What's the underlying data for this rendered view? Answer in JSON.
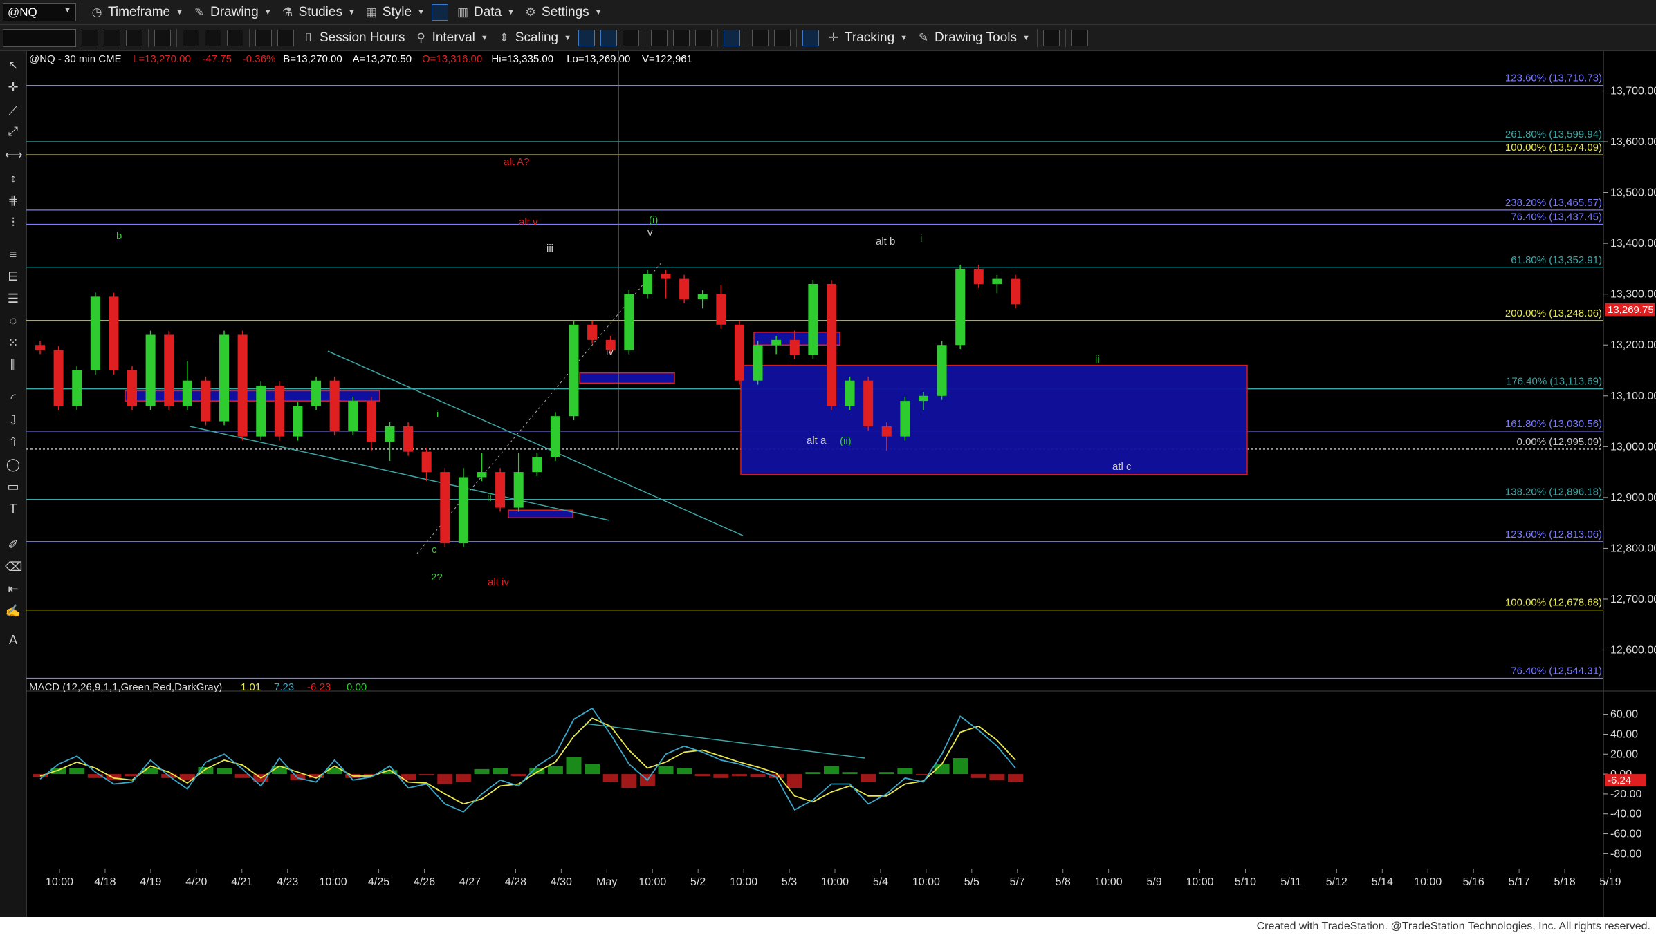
{
  "toolbar_top": {
    "symbol": "@NQ",
    "items": [
      {
        "name": "timeframe-button",
        "label": "Timeframe",
        "icon": "clock-icon"
      },
      {
        "name": "drawing-button",
        "label": "Drawing",
        "icon": "pen-icon"
      },
      {
        "name": "studies-button",
        "label": "Studies",
        "icon": "flask-icon"
      },
      {
        "name": "style-button",
        "label": "Style",
        "icon": "style-icon"
      },
      {
        "name": "data-button",
        "label": "Data",
        "icon": "bar-chart-icon"
      },
      {
        "name": "settings-button",
        "label": "Settings",
        "icon": "gear-icon"
      }
    ]
  },
  "toolbar_second": {
    "session_label": "Session Hours",
    "interval_label": "Interval",
    "scaling_label": "Scaling",
    "tracking_label": "Tracking",
    "drawing_tools_label": "Drawing Tools"
  },
  "chart_header": {
    "symbol_text": "@NQ - 30 min  CME",
    "last": "L=13,270.00",
    "change": "-47.75",
    "pct": "-0.36%",
    "bid": "B=13,270.00",
    "ask": "A=13,270.50",
    "open": "O=13,316.00",
    "high": "Hi=13,335.00",
    "low": "Lo=13,269.00",
    "volume": "V=122,961"
  },
  "macd_header": {
    "title": "MACD (12,26,9,1,1,Green,Red,DarkGray)",
    "v1": "1.01",
    "v2": "7.23",
    "v3": "-6.23",
    "v4": "0.00"
  },
  "footer_text": "Created with TradeStation. @TradeStation Technologies, Inc. All rights reserved.",
  "chart_data": [
    {
      "type": "candlestick",
      "title": "@NQ - 30 min",
      "y_ticks": [
        "13,700.00",
        "13,600.00",
        "13,500.00",
        "13,400.00",
        "13,300.00",
        "13,200.00",
        "13,100.00",
        "13,000.00",
        "12,900.00",
        "12,800.00",
        "12,700.00",
        "12,600.00"
      ],
      "ylim": [
        12530,
        13770
      ],
      "last_price": "13,269.75",
      "x_ticks": [
        "10:00",
        "4/18",
        "4/19",
        "4/20",
        "4/21",
        "4/23",
        "10:00",
        "4/25",
        "4/26",
        "4/27",
        "4/28",
        "4/30",
        "May",
        "10:00",
        "5/2",
        "10:00",
        "5/3",
        "10:00",
        "5/4",
        "10:00",
        "5/5",
        "5/7",
        "5/8",
        "10:00",
        "5/9",
        "10:00",
        "5/10",
        "5/11",
        "5/12",
        "5/14",
        "10:00",
        "5/16",
        "5/17",
        "5/18",
        "5/19"
      ],
      "fib_levels": [
        {
          "label": "123.60% (13,710.73)",
          "value": 13710.73,
          "color": "#7b7bff"
        },
        {
          "label": "261.80% (13,599.94)",
          "value": 13599.94,
          "color": "#3aa6a6"
        },
        {
          "label": "100.00% (13,574.09)",
          "value": 13574.09,
          "color": "#e8e84a"
        },
        {
          "label": "238.20% (13,465.57)",
          "value": 13465.57,
          "color": "#7b7bff"
        },
        {
          "label": "76.40% (13,437.45)",
          "value": 13437.45,
          "color": "#7b7bff"
        },
        {
          "label": "61.80% (13,352.91)",
          "value": 13352.91,
          "color": "#3aa6a6"
        },
        {
          "label": "200.00% (13,248.06)",
          "value": 13248.06,
          "color": "#e8e84a"
        },
        {
          "label": "176.40% (13,113.69)",
          "value": 13113.69,
          "color": "#3aa6a6"
        },
        {
          "label": "161.80% (13,030.56)",
          "value": 13030.56,
          "color": "#7b7bff"
        },
        {
          "label": "0.00% (12,995.09)",
          "value": 12995.09,
          "color": "#cccccc"
        },
        {
          "label": "138.20% (12,896.18)",
          "value": 12896.18,
          "color": "#3aa6a6"
        },
        {
          "label": "123.60% (12,813.06)",
          "value": 12813.06,
          "color": "#7b7bff"
        },
        {
          "label": "100.00% (12,678.68)",
          "value": 12678.68,
          "color": "#e8e84a"
        },
        {
          "label": "76.40% (12,544.31)",
          "value": 12544.31,
          "color": "#7b7bff"
        }
      ],
      "wave_labels": [
        {
          "text": "b",
          "color": "#3cc43c"
        },
        {
          "text": "alt A?",
          "color": "#e02020"
        },
        {
          "text": "alt v",
          "color": "#e02020"
        },
        {
          "text": "iii",
          "color": "#cccccc"
        },
        {
          "text": "(i)",
          "color": "#3cc43c"
        },
        {
          "text": "v",
          "color": "#cccccc"
        },
        {
          "text": "alt b",
          "color": "#cccccc"
        },
        {
          "text": "i",
          "color": "#3cc43c"
        },
        {
          "text": "iv",
          "color": "#cccccc"
        },
        {
          "text": "ii",
          "color": "#3cc43c"
        },
        {
          "text": "i",
          "color": "#3cc43c"
        },
        {
          "text": "alt a",
          "color": "#cccccc"
        },
        {
          "text": "(ii)",
          "color": "#3cc43c"
        },
        {
          "text": "atl c",
          "color": "#cccccc"
        },
        {
          "text": "ii",
          "color": "#3cc43c"
        },
        {
          "text": "c",
          "color": "#3cc43c"
        },
        {
          "text": "2?",
          "color": "#3cc43c"
        },
        {
          "text": "alt iv",
          "color": "#e02020"
        }
      ],
      "price_path": [
        [
          13200,
          13190
        ],
        [
          13140,
          13080
        ],
        [
          13100,
          13150
        ],
        [
          13210,
          13295
        ],
        [
          13220,
          13150
        ],
        [
          13130,
          13080
        ],
        [
          13160,
          13220
        ],
        [
          13120,
          13080
        ],
        [
          13160,
          13130
        ],
        [
          13080,
          13050
        ],
        [
          13140,
          13220
        ],
        [
          13050,
          13020
        ],
        [
          13090,
          13120
        ],
        [
          13080,
          13020
        ],
        [
          13040,
          13080
        ],
        [
          13100,
          13130
        ],
        [
          13060,
          13030
        ],
        [
          13050,
          13090
        ],
        [
          13000,
          13010
        ],
        [
          12980,
          13040
        ],
        [
          13010,
          12990
        ],
        [
          12940,
          12950
        ],
        [
          12900,
          12810
        ],
        [
          12950,
          12940
        ],
        [
          12980,
          12950
        ],
        [
          12900,
          12880
        ],
        [
          12980,
          12950
        ],
        [
          12960,
          12980
        ],
        [
          13020,
          13060
        ],
        [
          13100,
          13240
        ],
        [
          13220,
          13210
        ],
        [
          13200,
          13190
        ],
        [
          13240,
          13300
        ],
        [
          13310,
          13340
        ],
        [
          13300,
          13330
        ],
        [
          13310,
          13290
        ],
        [
          13280,
          13300
        ],
        [
          13310,
          13240
        ],
        [
          13180,
          13130
        ],
        [
          13180,
          13200
        ],
        [
          13190,
          13210
        ],
        [
          13220,
          13180
        ],
        [
          13260,
          13320
        ],
        [
          13150,
          13080
        ],
        [
          13100,
          13130
        ],
        [
          13080,
          13040
        ],
        [
          13000,
          13020
        ],
        [
          13060,
          13090
        ],
        [
          13080,
          13100
        ],
        [
          13120,
          13200
        ],
        [
          13320,
          13350
        ],
        [
          13330,
          13320
        ],
        [
          13310,
          13330
        ],
        [
          13300,
          13280
        ]
      ]
    },
    {
      "type": "macd",
      "title": "MACD (12,26,9,1,1,Green,Red,DarkGray)",
      "y_ticks": [
        "60.00",
        "40.00",
        "20.00",
        "0.00",
        "-20.00",
        "-40.00",
        "-60.00",
        "-80.00"
      ],
      "ylim": [
        -95,
        75
      ],
      "last_value": "-6.24",
      "macd": [
        -5,
        10,
        18,
        2,
        -10,
        -8,
        14,
        -2,
        -15,
        12,
        20,
        5,
        -12,
        16,
        -4,
        -8,
        14,
        -6,
        -3,
        8,
        -14,
        -10,
        -30,
        -38,
        -20,
        -6,
        -12,
        8,
        20,
        55,
        66,
        40,
        10,
        -6,
        20,
        28,
        22,
        14,
        10,
        4,
        -3,
        -36,
        -26,
        -10,
        -10,
        -30,
        -20,
        -4,
        -8,
        20,
        58,
        44,
        28,
        6
      ],
      "signal": [
        -2,
        4,
        12,
        6,
        -4,
        -6,
        8,
        2,
        -9,
        5,
        14,
        9,
        -4,
        8,
        2,
        -4,
        8,
        -2,
        -2,
        4,
        -8,
        -9,
        -20,
        -30,
        -25,
        -12,
        -10,
        2,
        12,
        38,
        56,
        48,
        24,
        6,
        12,
        22,
        24,
        18,
        12,
        7,
        1,
        -22,
        -28,
        -18,
        -12,
        -22,
        -22,
        -10,
        -7,
        10,
        42,
        48,
        34,
        14
      ]
    }
  ]
}
